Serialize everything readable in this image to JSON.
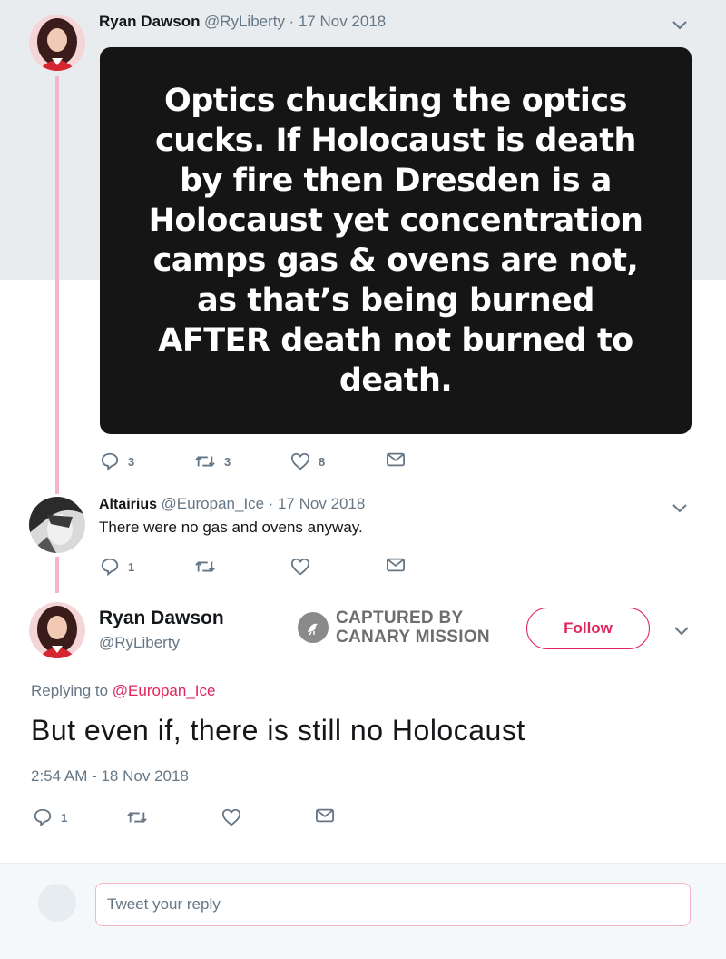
{
  "tweet1": {
    "name": "Ryan Dawson",
    "handle": "@RyLiberty",
    "date": "· 17 Nov 2018",
    "image_text": "Optics chucking the optics cucks. If Holocaust is death by fire then Dresden is a Holocaust yet concentration camps gas & ovens are not, as that’s being burned AFTER death not burned to death.",
    "replies": "3",
    "retweets": "3",
    "likes": "8"
  },
  "tweet2": {
    "name": "Altairius",
    "handle": "@Europan_Ice",
    "date": "· 17 Nov 2018",
    "text": "There were no gas and ovens anyway.",
    "replies": "1"
  },
  "main_tweet": {
    "name": "Ryan Dawson",
    "handle": "@RyLiberty",
    "follow_label": "Follow",
    "stamp_line1": "CAPTURED BY",
    "stamp_line2": "CANARY MISSION",
    "replying_prefix": "Replying to",
    "replying_handle": "@Europan_Ice",
    "text": "But even if, there is still no Holocaust",
    "timestamp": "2:54 AM - 18 Nov 2018",
    "replies": "1"
  },
  "compose": {
    "placeholder": "Tweet your reply"
  },
  "colors": {
    "accent": "#e0245e",
    "thread_line": "#f4b6c8",
    "muted": "#657786"
  }
}
